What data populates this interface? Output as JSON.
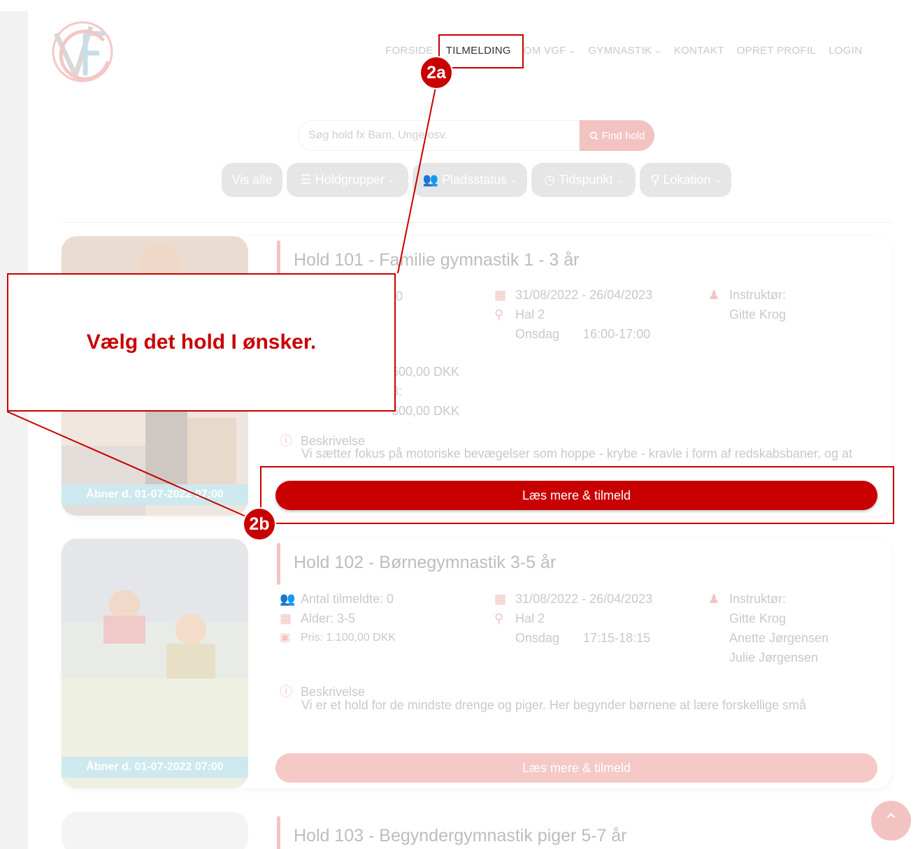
{
  "nav": {
    "items": [
      {
        "label": "FORSIDE",
        "has_dropdown": false,
        "active": false
      },
      {
        "label": "TILMELDING",
        "has_dropdown": false,
        "active": true
      },
      {
        "label": "OM VGF",
        "has_dropdown": true,
        "active": false
      },
      {
        "label": "GYMNASTIK",
        "has_dropdown": true,
        "active": false
      },
      {
        "label": "KONTAKT",
        "has_dropdown": false,
        "active": false
      },
      {
        "label": "OPRET PROFIL",
        "has_dropdown": false,
        "active": false
      },
      {
        "label": "LOGIN",
        "has_dropdown": false,
        "active": false
      }
    ]
  },
  "search": {
    "placeholder": "Søg hold fx Barn, Unge osv.",
    "button_label": "Find hold"
  },
  "filters": {
    "show_all": "Vis alle",
    "groups": "Holdgrupper",
    "capacity": "Pladsstatus",
    "time": "Tidspunkt",
    "location": "Lokation"
  },
  "cards": [
    {
      "title": "Hold 101 - Familie gymnastik 1 - 3 år",
      "opens": "Åbner d. 01-07-2022 07:00",
      "left_col_partial": [
        "0",
        ":",
        "600,00 DKK",
        "3:",
        "600,00 DKK"
      ],
      "dates": "31/08/2022 - 26/04/2023",
      "venue": "Hal 2",
      "day": "Onsdag",
      "time": "16:00-17:00",
      "instructor_label": "Instruktør:",
      "instructors": [
        "Gitte Krog"
      ],
      "description_label": "Beskrivelse",
      "description": "Vi sætter fokus på motoriske bevægelser som hoppe - krybe - kravle i form af redskabsbaner, og at",
      "cta": "Læs mere & tilmeld"
    },
    {
      "title": "Hold 102 - Børnegymnastik 3-5 år",
      "opens": "Åbner d. 01-07-2022 07:00",
      "participants": "Antal tilmeldte: 0",
      "age": "Alder: 3-5",
      "price": "Pris: 1.100,00 DKK",
      "dates": "31/08/2022 - 26/04/2023",
      "venue": "Hal 2",
      "day": "Onsdag",
      "time": "17:15-18:15",
      "instructor_label": "Instruktør:",
      "instructors": [
        "Gitte Krog",
        "Anette Jørgensen",
        "Julie Jørgensen"
      ],
      "description_label": "Beskrivelse",
      "description": "Vi er et hold for de mindste drenge og piger. Her begynder børnene at lære forskellige små",
      "cta": "Læs mere & tilmeld"
    },
    {
      "title": "Hold 103 - Begyndergymnastik piger 5-7 år"
    }
  ],
  "annotation": {
    "callout_text": "Vælg det hold I ønsker.",
    "marker_a": "2a",
    "marker_b": "2b",
    "color": "#c80000"
  },
  "colors": {
    "accent": "#c80000",
    "accent_faded": "#f3c3c1",
    "tag_bg": "#cde9ef"
  },
  "icons": {
    "search": "search-icon",
    "list": "list-icon",
    "users": "users-icon",
    "clock": "clock-icon",
    "pin": "map-pin-icon",
    "calendar": "calendar-icon",
    "person": "person-icon",
    "info": "info-icon",
    "money": "money-icon",
    "to_top": "chevron-up-icon"
  }
}
